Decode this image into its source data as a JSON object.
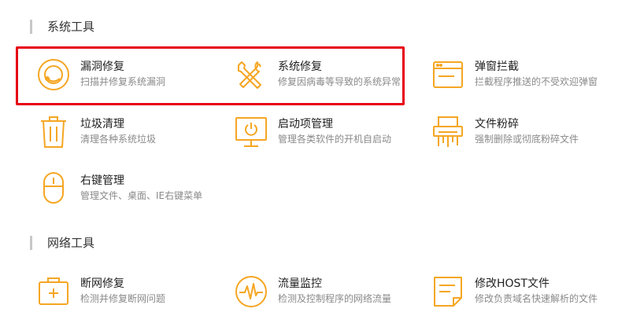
{
  "accent_color": "#f5a623",
  "highlight_color": "#e60012",
  "sections": [
    {
      "title": "系统工具",
      "tools": [
        {
          "name": "漏洞修复",
          "desc": "扫描并修复系统漏洞",
          "icon": "vulnerability-repair-icon"
        },
        {
          "name": "系统修复",
          "desc": "修复因病毒等导致的系统异常",
          "icon": "wrench-screwdriver-icon"
        },
        {
          "name": "弹窗拦截",
          "desc": "拦截程序推送的不受欢迎弹窗",
          "icon": "popup-window-icon"
        },
        {
          "name": "垃圾清理",
          "desc": "清理各种系统垃圾",
          "icon": "trash-can-icon"
        },
        {
          "name": "启动项管理",
          "desc": "管理各类软件的开机自启动",
          "icon": "monitor-power-icon"
        },
        {
          "name": "文件粉碎",
          "desc": "强制删除或彻底粉碎文件",
          "icon": "shredder-icon"
        },
        {
          "name": "右键管理",
          "desc": "管理文件、桌面、IE右键菜单",
          "icon": "mouse-icon"
        }
      ]
    },
    {
      "title": "网络工具",
      "tools": [
        {
          "name": "断网修复",
          "desc": "检测并修复断网问题",
          "icon": "first-aid-kit-icon"
        },
        {
          "name": "流量监控",
          "desc": "检测及控制程序的网络流量",
          "icon": "traffic-pulse-icon"
        },
        {
          "name": "修改HOST文件",
          "desc": "修改负责域名快速解析的文件",
          "icon": "document-edit-icon"
        }
      ]
    }
  ]
}
